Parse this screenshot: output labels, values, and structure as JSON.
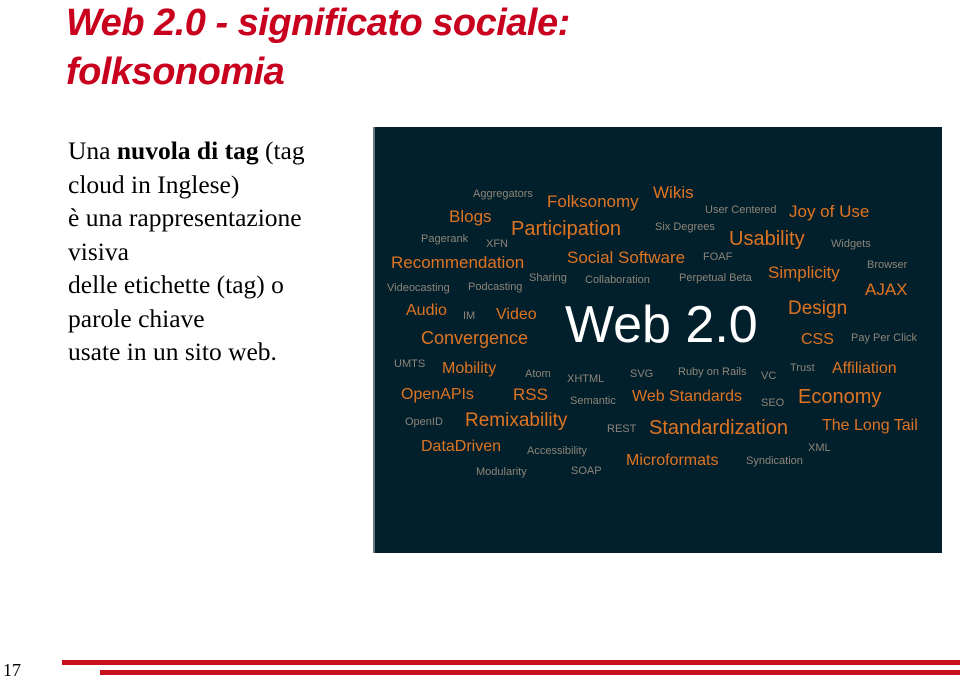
{
  "slide": {
    "title_line1": "Web 2.0 -  significato sociale:",
    "title_line2": "folksonomia",
    "body": {
      "intro": "Una ",
      "bold": "nuvola di  tag",
      "rest1": " (tag",
      "line2": "cloud in Inglese)",
      "line3": "è una rappresentazione",
      "line4": "visiva",
      "line5": "delle etichette (tag) o",
      "line6": "parole chiave",
      "line7": "usate in un sito web."
    },
    "page_number": "17",
    "accent_color": "#c8001e"
  },
  "tag_cloud": {
    "background": "#02202c",
    "center": "Web 2.0",
    "tags": [
      {
        "text": "Aggregators",
        "style": "g"
      },
      {
        "text": "Folksonomy",
        "style": "o"
      },
      {
        "text": "Wikis",
        "style": "o"
      },
      {
        "text": "Blogs",
        "style": "o"
      },
      {
        "text": "Participation",
        "style": "o"
      },
      {
        "text": "Six Degrees",
        "style": "g"
      },
      {
        "text": "User Centered",
        "style": "g"
      },
      {
        "text": "Joy of Use",
        "style": "o"
      },
      {
        "text": "Pagerank",
        "style": "g"
      },
      {
        "text": "XFN",
        "style": "g"
      },
      {
        "text": "Usability",
        "style": "o"
      },
      {
        "text": "Widgets",
        "style": "g"
      },
      {
        "text": "Recommendation",
        "style": "o"
      },
      {
        "text": "Social Software",
        "style": "o"
      },
      {
        "text": "FOAF",
        "style": "g"
      },
      {
        "text": "Browser",
        "style": "g"
      },
      {
        "text": "Sharing",
        "style": "g"
      },
      {
        "text": "Collaboration",
        "style": "g"
      },
      {
        "text": "Perpetual Beta",
        "style": "g"
      },
      {
        "text": "Simplicity",
        "style": "o"
      },
      {
        "text": "Videocasting",
        "style": "g"
      },
      {
        "text": "Podcasting",
        "style": "g"
      },
      {
        "text": "AJAX",
        "style": "o"
      },
      {
        "text": "Audio",
        "style": "o"
      },
      {
        "text": "IM",
        "style": "g"
      },
      {
        "text": "Video",
        "style": "o"
      },
      {
        "text": "Design",
        "style": "o"
      },
      {
        "text": "Convergence",
        "style": "o"
      },
      {
        "text": "CSS",
        "style": "o"
      },
      {
        "text": "Pay Per Click",
        "style": "g"
      },
      {
        "text": "UMTS",
        "style": "g"
      },
      {
        "text": "Mobility",
        "style": "o"
      },
      {
        "text": "Atom",
        "style": "g"
      },
      {
        "text": "XHTML",
        "style": "g"
      },
      {
        "text": "SVG",
        "style": "g"
      },
      {
        "text": "Ruby on Rails",
        "style": "g"
      },
      {
        "text": "VC",
        "style": "g"
      },
      {
        "text": "Trust",
        "style": "g"
      },
      {
        "text": "Affiliation",
        "style": "o"
      },
      {
        "text": "OpenAPIs",
        "style": "o"
      },
      {
        "text": "RSS",
        "style": "o"
      },
      {
        "text": "Semantic",
        "style": "g"
      },
      {
        "text": "Web Standards",
        "style": "o"
      },
      {
        "text": "SEO",
        "style": "g"
      },
      {
        "text": "Economy",
        "style": "o"
      },
      {
        "text": "OpenID",
        "style": "g"
      },
      {
        "text": "Remixability",
        "style": "o"
      },
      {
        "text": "REST",
        "style": "g"
      },
      {
        "text": "Standardization",
        "style": "o"
      },
      {
        "text": "The Long Tail",
        "style": "o"
      },
      {
        "text": "DataDriven",
        "style": "o"
      },
      {
        "text": "Accessibility",
        "style": "g"
      },
      {
        "text": "XML",
        "style": "g"
      },
      {
        "text": "Microformats",
        "style": "o"
      },
      {
        "text": "Syndication",
        "style": "g"
      },
      {
        "text": "Modularity",
        "style": "g"
      },
      {
        "text": "SOAP",
        "style": "g"
      }
    ]
  }
}
